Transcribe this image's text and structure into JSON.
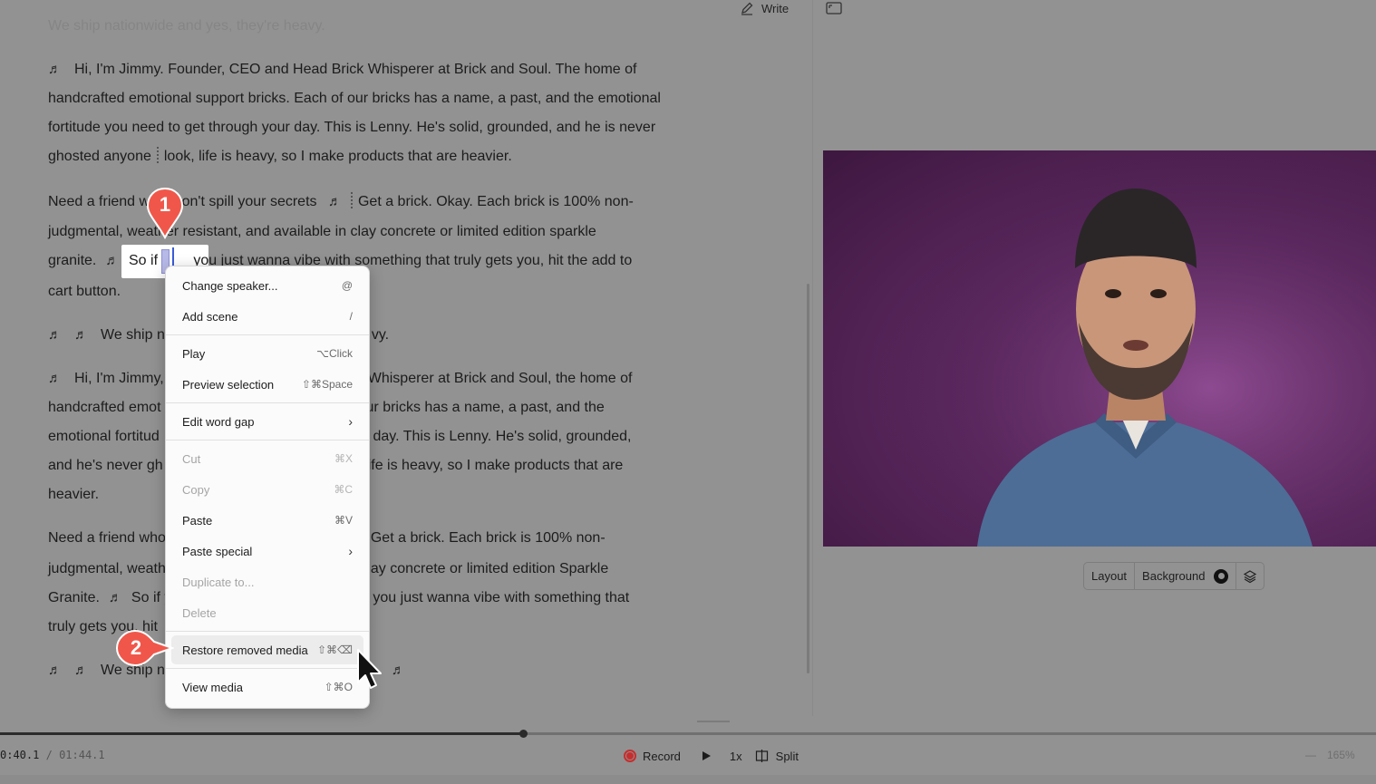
{
  "toolbar": {
    "write_label": "Write"
  },
  "transcript": {
    "ghost_line": "We ship nationwide and yes, they're heavy.",
    "p1": {
      "note": "♬",
      "before_gap": "Hi, I'm Jimmy. Founder, CEO and Head Brick Whisperer at Brick and Soul. The home of handcrafted emotional support bricks. Each of our bricks has a name, a past, and the emotional fortitude you need to get through your day. This is Lenny. He's solid, grounded, and he is never ghosted anyone",
      "after_gap": "look, life is heavy, so I make products that are heavier."
    },
    "p2": {
      "line1a": "Need a friend w",
      "line1b": "won't spill your secrets",
      "note1": "♬",
      "line1c": "Get a brick. Okay. Each brick is 100% non-",
      "line2": "judgmental, weather resistant, and available in clay concrete or limited edition sparkle",
      "line3a": "granite.",
      "note2": "♬",
      "highlight_text": "So if",
      "line3b": "you just wanna vibe with something that truly gets you, hit the add to",
      "line4": "cart button."
    },
    "p3": {
      "note1": "♬",
      "note2": "♬",
      "text_a": "We ship n",
      "text_b": "vy."
    },
    "p4": {
      "note": "♬",
      "l1a": "Hi, I'm Jimmy,",
      "l1b": "Whisperer at Brick and Soul, the home of",
      "l2a": "handcrafted emot",
      "l2b": "ur bricks has a name, a past, and the",
      "l3a": "emotional fortitud",
      "l3b": "r day. This is Lenny. He's solid, grounded,",
      "l4a": "and he's never gh",
      "l4b": "ife is heavy, so I make products that are",
      "l5": "heavier."
    },
    "p5": {
      "l1a": "Need a friend who",
      "l1b": "Get a brick. Each brick is 100% non-",
      "l2a": "judgmental, weath",
      "l2b": "ay concrete or limited edition Sparkle",
      "l3a": "Granite.",
      "note": "♬",
      "l3b": "So if y",
      "l3c": "you just wanna vibe with something that",
      "l4a": "truly gets you, hit"
    },
    "p6": {
      "note1": "♬",
      "note2": "♬",
      "text_a": "We ship n",
      "note3": "♬"
    }
  },
  "context_menu": {
    "items": [
      {
        "label": "Change speaker...",
        "shortcut": "@"
      },
      {
        "label": "Add scene",
        "shortcut": "/"
      },
      {
        "label": "Play",
        "shortcut": "⌥Click"
      },
      {
        "label": "Preview selection",
        "shortcut": "⇧⌘Space"
      },
      {
        "label": "Edit word gap",
        "shortcut": "›"
      },
      {
        "label": "Cut",
        "shortcut": "⌘X"
      },
      {
        "label": "Copy",
        "shortcut": "⌘C"
      },
      {
        "label": "Paste",
        "shortcut": "⌘V"
      },
      {
        "label": "Paste special",
        "shortcut": "›"
      },
      {
        "label": "Duplicate to...",
        "shortcut": ""
      },
      {
        "label": "Delete",
        "shortcut": ""
      },
      {
        "label": "Restore removed media",
        "shortcut": "⇧⌘⌫"
      },
      {
        "label": "View media",
        "shortcut": "⇧⌘O"
      }
    ]
  },
  "callouts": {
    "first": "1",
    "second": "2"
  },
  "video_tools": {
    "layout": "Layout",
    "background": "Background"
  },
  "playback": {
    "current_time": "0:40.1",
    "separator": "/",
    "total_time": "01:44.1",
    "record_label": "Record",
    "speed": "1x",
    "split_label": "Split",
    "zoom": "165%",
    "progress": 0.38
  },
  "colors": {
    "background": "#929292",
    "record": "#c62d2d",
    "callout": "#f0574a",
    "selection": "#3b5bd9"
  },
  "icons": [
    "pen-icon",
    "frame-icon",
    "music-note-icon",
    "layers-icon",
    "play-icon",
    "split-icon",
    "record-icon",
    "pointer-icon",
    "chevron-right-icon"
  ]
}
